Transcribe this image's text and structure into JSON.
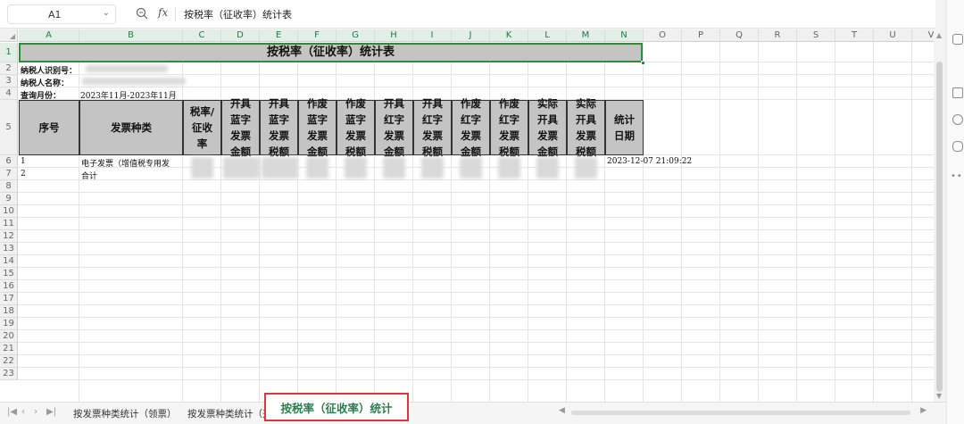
{
  "formula_bar": {
    "cell_ref": "A1",
    "fx_label": "fx",
    "content": "按税率（征收率）统计表"
  },
  "columns": [
    "A",
    "B",
    "C",
    "D",
    "E",
    "F",
    "G",
    "H",
    "I",
    "J",
    "K",
    "L",
    "M",
    "N",
    "O",
    "P",
    "Q",
    "R",
    "S",
    "T",
    "U",
    "V"
  ],
  "rows": [
    "1",
    "2",
    "3",
    "4",
    "5",
    "6",
    "7",
    "8",
    "9",
    "10",
    "11",
    "12",
    "13",
    "14",
    "15",
    "16",
    "17",
    "18",
    "19",
    "20",
    "21",
    "22",
    "23"
  ],
  "title": "按税率（征收率）统计表",
  "info": {
    "taxpayer_id_label": "纳税人识别号：",
    "taxpayer_name_label": "纳税人名称：",
    "query_month_label": "查询月份：",
    "query_month_value": "2023年11月-2023年11月"
  },
  "table_header": {
    "seq": "序号",
    "invoice_type": "发票种类",
    "rate": [
      "税率/",
      "征收",
      "率"
    ],
    "blue_amount": [
      "开具",
      "蓝字",
      "发票",
      "金额"
    ],
    "blue_tax": [
      "开具",
      "蓝字",
      "发票",
      "税额"
    ],
    "void_blue_amount": [
      "作废",
      "蓝字",
      "发票",
      "金额"
    ],
    "void_blue_tax": [
      "作废",
      "蓝字",
      "发票",
      "税额"
    ],
    "red_amount": [
      "开具",
      "红字",
      "发票",
      "金额"
    ],
    "red_tax": [
      "开具",
      "红字",
      "发票",
      "税额"
    ],
    "void_red_amount": [
      "作废",
      "红字",
      "发票",
      "金额"
    ],
    "void_red_tax": [
      "作废",
      "红字",
      "发票",
      "税额"
    ],
    "actual_amount": [
      "实际",
      "开具",
      "发票",
      "金额"
    ],
    "actual_tax": [
      "实际",
      "开具",
      "发票",
      "税额"
    ],
    "stat_date": [
      "统计",
      "日期"
    ]
  },
  "table_rows": [
    {
      "seq": "1",
      "type": "电子发票（增值税专用发",
      "date": "2023-12-07 21:09:22"
    },
    {
      "seq": "2",
      "type": "合计"
    }
  ],
  "sheet_tabs": {
    "tab1": "按发票种类统计（领票）",
    "tab2": "按发票种类统计（开",
    "active": "按税率（征收率）统计"
  },
  "colors": {
    "accent_green": "#2e8b3e",
    "active_tab_border": "#d9363e",
    "header_fill": "#c4c4c4"
  }
}
